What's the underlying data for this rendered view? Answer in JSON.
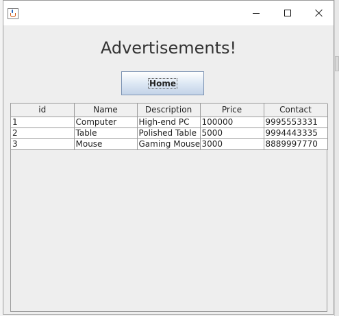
{
  "window": {
    "icon": "java-cup-icon",
    "controls": {
      "minimize": "minimize-icon",
      "maximize": "maximize-icon",
      "close": "close-icon"
    }
  },
  "heading": "Advertisements!",
  "home_button": "Home",
  "table": {
    "columns": [
      "id",
      "Name",
      "Description",
      "Price",
      "Contact"
    ],
    "rows": [
      [
        "1",
        "Computer",
        "High-end PC",
        "100000",
        "9995553331"
      ],
      [
        "2",
        "Table",
        "Polished Table",
        "5000",
        "9994443335"
      ],
      [
        "3",
        "Mouse",
        "Gaming Mouse",
        "3000",
        "8889997770"
      ]
    ]
  }
}
